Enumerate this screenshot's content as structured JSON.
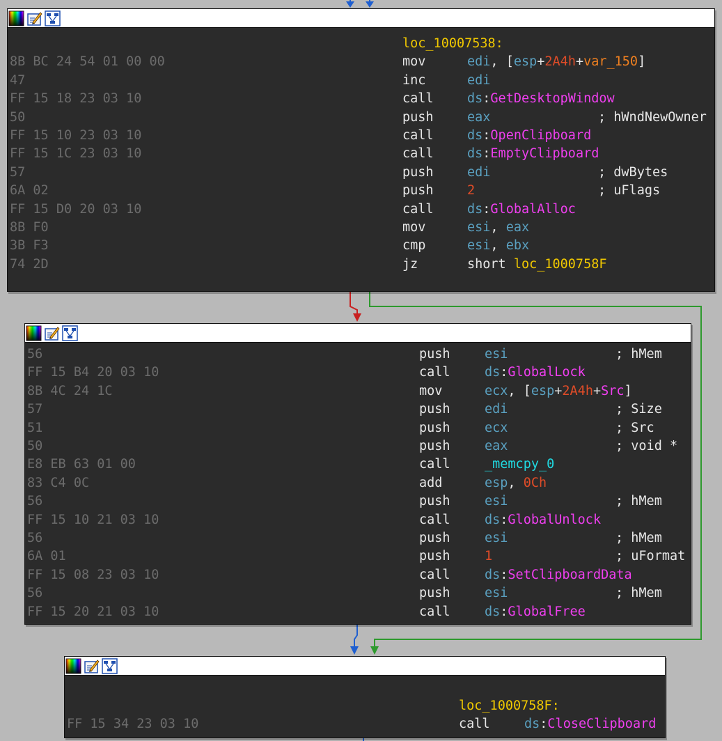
{
  "colors": {
    "background": "#b9b9b9",
    "node_bg": "#2b2b2b",
    "bytes": "#6b6b6b",
    "label": "#f0c800",
    "register": "#5aa0c0",
    "number": "#e04c28",
    "variable": "#f08020",
    "import": "#ef3fef",
    "function": "#20d8e0",
    "edge_true": "#2e9a2e",
    "edge_false": "#c82020",
    "edge_normal": "#1f5fd0"
  },
  "header_icons": [
    "color-palette-icon",
    "edit-node-icon",
    "graph-overview-icon"
  ],
  "blocks": [
    {
      "id": "block-1",
      "lines": [
        {
          "bytes": "",
          "label": "loc_10007538:",
          "mnemonic": "",
          "operands": [],
          "comment": ""
        },
        {
          "bytes": "8B BC 24 54 01 00 00",
          "label": "",
          "mnemonic": "mov",
          "operands": [
            {
              "t": "reg",
              "v": "edi"
            },
            {
              "t": "plain",
              "v": ", ["
            },
            {
              "t": "reg",
              "v": "esp"
            },
            {
              "t": "plain",
              "v": "+"
            },
            {
              "t": "num",
              "v": "2A4h"
            },
            {
              "t": "plain",
              "v": "+"
            },
            {
              "t": "var",
              "v": "var_150"
            },
            {
              "t": "plain",
              "v": "]"
            }
          ],
          "comment": ""
        },
        {
          "bytes": "47",
          "label": "",
          "mnemonic": "inc",
          "operands": [
            {
              "t": "reg",
              "v": "edi"
            }
          ],
          "comment": ""
        },
        {
          "bytes": "FF 15 18 23 03 10",
          "label": "",
          "mnemonic": "call",
          "operands": [
            {
              "t": "reg",
              "v": "ds"
            },
            {
              "t": "plain",
              "v": ":"
            },
            {
              "t": "api",
              "v": "GetDesktopWindow"
            }
          ],
          "comment": ""
        },
        {
          "bytes": "50",
          "label": "",
          "mnemonic": "push",
          "operands": [
            {
              "t": "reg",
              "v": "eax"
            }
          ],
          "comment": "; hWndNewOwner"
        },
        {
          "bytes": "FF 15 10 23 03 10",
          "label": "",
          "mnemonic": "call",
          "operands": [
            {
              "t": "reg",
              "v": "ds"
            },
            {
              "t": "plain",
              "v": ":"
            },
            {
              "t": "api",
              "v": "OpenClipboard"
            }
          ],
          "comment": ""
        },
        {
          "bytes": "FF 15 1C 23 03 10",
          "label": "",
          "mnemonic": "call",
          "operands": [
            {
              "t": "reg",
              "v": "ds"
            },
            {
              "t": "plain",
              "v": ":"
            },
            {
              "t": "api",
              "v": "EmptyClipboard"
            }
          ],
          "comment": ""
        },
        {
          "bytes": "57",
          "label": "",
          "mnemonic": "push",
          "operands": [
            {
              "t": "reg",
              "v": "edi"
            }
          ],
          "comment": "; dwBytes"
        },
        {
          "bytes": "6A 02",
          "label": "",
          "mnemonic": "push",
          "operands": [
            {
              "t": "num",
              "v": "2"
            }
          ],
          "comment": "; uFlags"
        },
        {
          "bytes": "FF 15 D0 20 03 10",
          "label": "",
          "mnemonic": "call",
          "operands": [
            {
              "t": "reg",
              "v": "ds"
            },
            {
              "t": "plain",
              "v": ":"
            },
            {
              "t": "api",
              "v": "GlobalAlloc"
            }
          ],
          "comment": ""
        },
        {
          "bytes": "8B F0",
          "label": "",
          "mnemonic": "mov",
          "operands": [
            {
              "t": "reg",
              "v": "esi"
            },
            {
              "t": "plain",
              "v": ", "
            },
            {
              "t": "reg",
              "v": "eax"
            }
          ],
          "comment": ""
        },
        {
          "bytes": "3B F3",
          "label": "",
          "mnemonic": "cmp",
          "operands": [
            {
              "t": "reg",
              "v": "esi"
            },
            {
              "t": "plain",
              "v": ", "
            },
            {
              "t": "reg",
              "v": "ebx"
            }
          ],
          "comment": ""
        },
        {
          "bytes": "74 2D",
          "label": "",
          "mnemonic": "jz",
          "operands": [
            {
              "t": "plain",
              "v": "short "
            },
            {
              "t": "loc",
              "v": "loc_1000758F"
            }
          ],
          "comment": ""
        }
      ]
    },
    {
      "id": "block-2",
      "lines": [
        {
          "bytes": "56",
          "label": "",
          "mnemonic": "push",
          "operands": [
            {
              "t": "reg",
              "v": "esi"
            }
          ],
          "comment": "; hMem"
        },
        {
          "bytes": "FF 15 B4 20 03 10",
          "label": "",
          "mnemonic": "call",
          "operands": [
            {
              "t": "reg",
              "v": "ds"
            },
            {
              "t": "plain",
              "v": ":"
            },
            {
              "t": "api",
              "v": "GlobalLock"
            }
          ],
          "comment": ""
        },
        {
          "bytes": "8B 4C 24 1C",
          "label": "",
          "mnemonic": "mov",
          "operands": [
            {
              "t": "reg",
              "v": "ecx"
            },
            {
              "t": "plain",
              "v": ", ["
            },
            {
              "t": "reg",
              "v": "esp"
            },
            {
              "t": "plain",
              "v": "+"
            },
            {
              "t": "num",
              "v": "2A4h"
            },
            {
              "t": "plain",
              "v": "+"
            },
            {
              "t": "api",
              "v": "Src"
            },
            {
              "t": "plain",
              "v": "]"
            }
          ],
          "comment": ""
        },
        {
          "bytes": "57",
          "label": "",
          "mnemonic": "push",
          "operands": [
            {
              "t": "reg",
              "v": "edi"
            }
          ],
          "comment": "; Size"
        },
        {
          "bytes": "51",
          "label": "",
          "mnemonic": "push",
          "operands": [
            {
              "t": "reg",
              "v": "ecx"
            }
          ],
          "comment": "; Src"
        },
        {
          "bytes": "50",
          "label": "",
          "mnemonic": "push",
          "operands": [
            {
              "t": "reg",
              "v": "eax"
            }
          ],
          "comment": "; void *"
        },
        {
          "bytes": "E8 EB 63 01 00",
          "label": "",
          "mnemonic": "call",
          "operands": [
            {
              "t": "func",
              "v": "_memcpy_0"
            }
          ],
          "comment": ""
        },
        {
          "bytes": "83 C4 0C",
          "label": "",
          "mnemonic": "add",
          "operands": [
            {
              "t": "reg",
              "v": "esp"
            },
            {
              "t": "plain",
              "v": ", "
            },
            {
              "t": "num",
              "v": "0Ch"
            }
          ],
          "comment": ""
        },
        {
          "bytes": "56",
          "label": "",
          "mnemonic": "push",
          "operands": [
            {
              "t": "reg",
              "v": "esi"
            }
          ],
          "comment": "; hMem"
        },
        {
          "bytes": "FF 15 10 21 03 10",
          "label": "",
          "mnemonic": "call",
          "operands": [
            {
              "t": "reg",
              "v": "ds"
            },
            {
              "t": "plain",
              "v": ":"
            },
            {
              "t": "api",
              "v": "GlobalUnlock"
            }
          ],
          "comment": ""
        },
        {
          "bytes": "56",
          "label": "",
          "mnemonic": "push",
          "operands": [
            {
              "t": "reg",
              "v": "esi"
            }
          ],
          "comment": "; hMem"
        },
        {
          "bytes": "6A 01",
          "label": "",
          "mnemonic": "push",
          "operands": [
            {
              "t": "num",
              "v": "1"
            }
          ],
          "comment": "; uFormat"
        },
        {
          "bytes": "FF 15 08 23 03 10",
          "label": "",
          "mnemonic": "call",
          "operands": [
            {
              "t": "reg",
              "v": "ds"
            },
            {
              "t": "plain",
              "v": ":"
            },
            {
              "t": "api",
              "v": "SetClipboardData"
            }
          ],
          "comment": ""
        },
        {
          "bytes": "56",
          "label": "",
          "mnemonic": "push",
          "operands": [
            {
              "t": "reg",
              "v": "esi"
            }
          ],
          "comment": "; hMem"
        },
        {
          "bytes": "FF 15 20 21 03 10",
          "label": "",
          "mnemonic": "call",
          "operands": [
            {
              "t": "reg",
              "v": "ds"
            },
            {
              "t": "plain",
              "v": ":"
            },
            {
              "t": "api",
              "v": "GlobalFree"
            }
          ],
          "comment": ""
        }
      ]
    },
    {
      "id": "block-3",
      "lines": [
        {
          "bytes": "",
          "label": "loc_1000758F:",
          "mnemonic": "",
          "operands": [],
          "comment": ""
        },
        {
          "bytes": "FF 15 34 23 03 10",
          "label": "",
          "mnemonic": "call",
          "operands": [
            {
              "t": "reg",
              "v": "ds"
            },
            {
              "t": "plain",
              "v": ":"
            },
            {
              "t": "api",
              "v": "CloseClipboard"
            }
          ],
          "comment": ""
        }
      ]
    }
  ]
}
